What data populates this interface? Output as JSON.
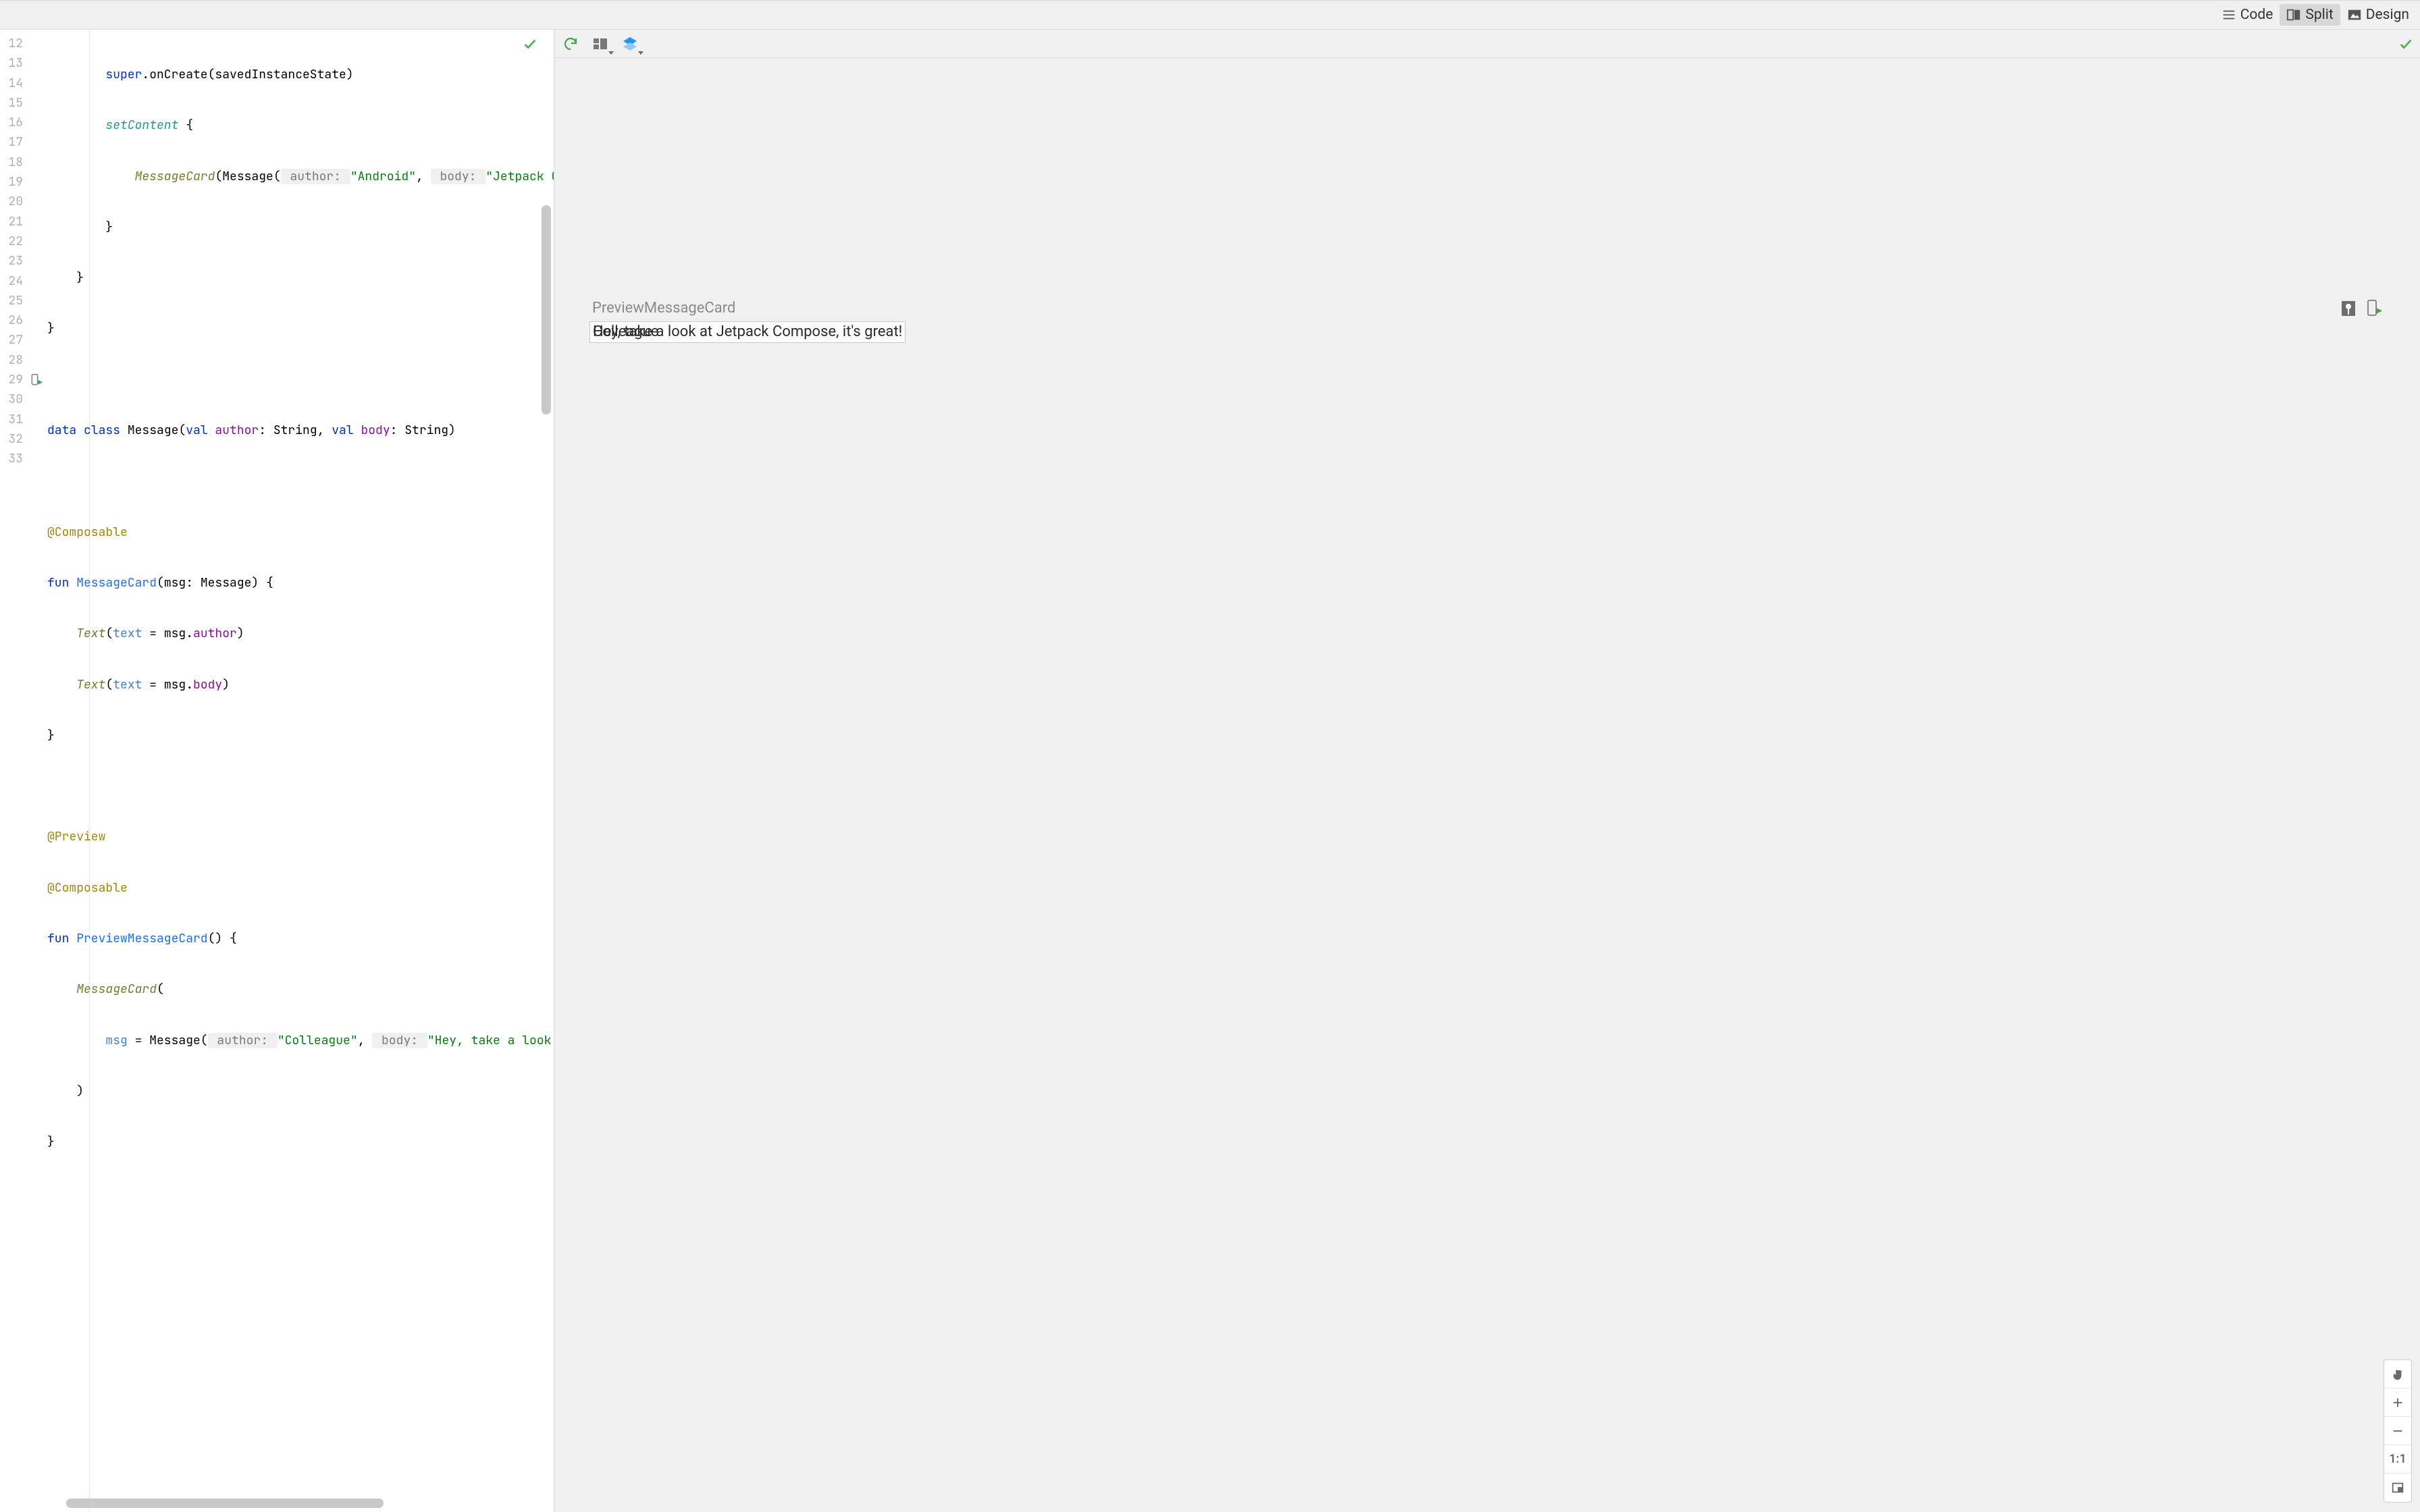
{
  "viewTabs": {
    "code": "Code",
    "split": "Split",
    "design": "Design"
  },
  "gutterStart": 12,
  "gutterEnd": 33,
  "previewGutterLine": 29,
  "code": {
    "l12": {
      "super": "super",
      "onCreate": ".onCreate(savedInstanceState)"
    },
    "l13": {
      "setContent": "setContent",
      "brace": " {"
    },
    "l14": {
      "MessageCard": "MessageCard",
      "open": "(Message(",
      "authorHint": " author: ",
      "authorStr": "\"Android\"",
      "comma": ", ",
      "bodyHint": " body: ",
      "bodyStr": "\"Jetpack Com"
    },
    "l15": "}",
    "l16": "}",
    "l17": "}",
    "l19": {
      "data": "data",
      "class": "class",
      "name": " Message(",
      "val1": "val",
      "author": " author",
      "t1": ": String, ",
      "val2": "val",
      "body": " body",
      "t2": ": String)"
    },
    "l21": "@Composable",
    "l22": {
      "fun": "fun",
      "name": " MessageCard",
      "sig": "(msg: Message) {"
    },
    "l23": {
      "Text": "Text",
      "open": "(",
      "text": "text",
      "eq": " = msg.",
      "memb": "author",
      "close": ")"
    },
    "l24": {
      "Text": "Text",
      "open": "(",
      "text": "text",
      "eq": " = msg.",
      "memb": "body",
      "close": ")"
    },
    "l25": "}",
    "l27": "@Preview",
    "l28": "@Composable",
    "l29": {
      "fun": "fun",
      "name": " PreviewMessageCard",
      "sig": "() {"
    },
    "l30": {
      "MessageCard": "MessageCard",
      "open": "("
    },
    "l31": {
      "msg": "msg",
      "eq": " = Message(",
      "authorHint": " author: ",
      "authorStr": "\"Colleague\"",
      "comma": ", ",
      "bodyHint": " body: ",
      "bodyStr": "\"Hey, take a look at"
    },
    "l32": ")",
    "l33": "}"
  },
  "preview": {
    "label": "PreviewMessageCard",
    "text_body": "Hey, take a look at Jetpack Compose, it's great!",
    "text_author": "Colleague"
  },
  "zoom": {
    "ratio": "1:1"
  }
}
